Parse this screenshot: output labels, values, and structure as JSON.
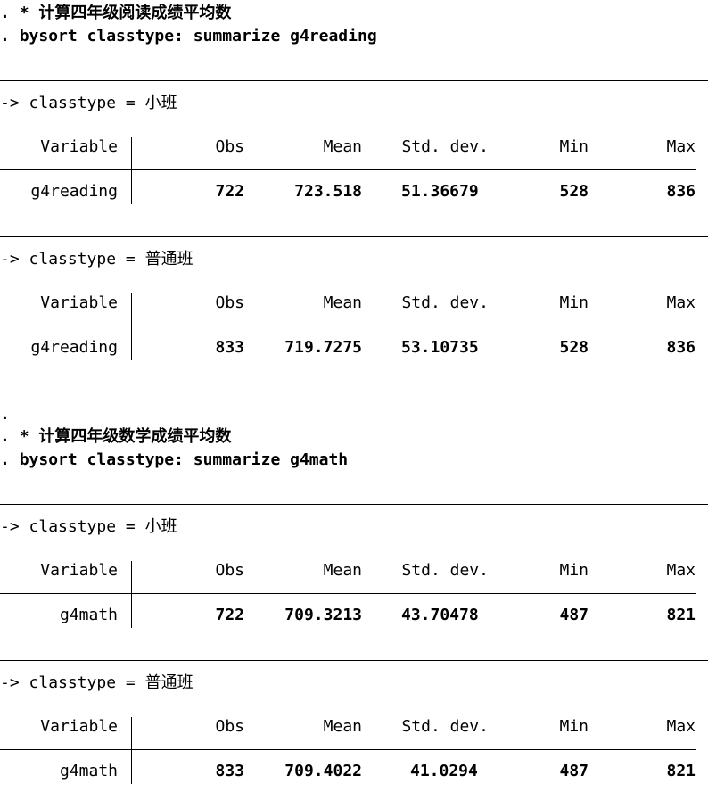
{
  "prompt": ".",
  "comment_marker": "*",
  "by_prefix": "->",
  "blocks": [
    {
      "comment": "计算四年级阅读成绩平均数",
      "command": "bysort classtype: summarize g4reading",
      "groups": [
        {
          "by_var": "classtype",
          "eq": "=",
          "by_value": "小班",
          "header": [
            "Variable",
            "Obs",
            "Mean",
            "Std. dev.",
            "Min",
            "Max"
          ],
          "row": {
            "variable": "g4reading",
            "obs": "722",
            "mean": "723.518",
            "sd": "51.36679",
            "min": "528",
            "max": "836"
          }
        },
        {
          "by_var": "classtype",
          "eq": "=",
          "by_value": "普通班",
          "header": [
            "Variable",
            "Obs",
            "Mean",
            "Std. dev.",
            "Min",
            "Max"
          ],
          "row": {
            "variable": "g4reading",
            "obs": "833",
            "mean": "719.7275",
            "sd": "53.10735",
            "min": "528",
            "max": "836"
          }
        }
      ]
    },
    {
      "comment": "计算四年级数学成绩平均数",
      "command": "bysort classtype: summarize g4math",
      "groups": [
        {
          "by_var": "classtype",
          "eq": "=",
          "by_value": "小班",
          "header": [
            "Variable",
            "Obs",
            "Mean",
            "Std. dev.",
            "Min",
            "Max"
          ],
          "row": {
            "variable": "g4math",
            "obs": "722",
            "mean": "709.3213",
            "sd": "43.70478",
            "min": "487",
            "max": "821"
          }
        },
        {
          "by_var": "classtype",
          "eq": "=",
          "by_value": "普通班",
          "header": [
            "Variable",
            "Obs",
            "Mean",
            "Std. dev.",
            "Min",
            "Max"
          ],
          "row": {
            "variable": "g4math",
            "obs": "833",
            "mean": "709.4022",
            "sd": "41.0294",
            "min": "487",
            "max": "821"
          }
        }
      ]
    }
  ]
}
